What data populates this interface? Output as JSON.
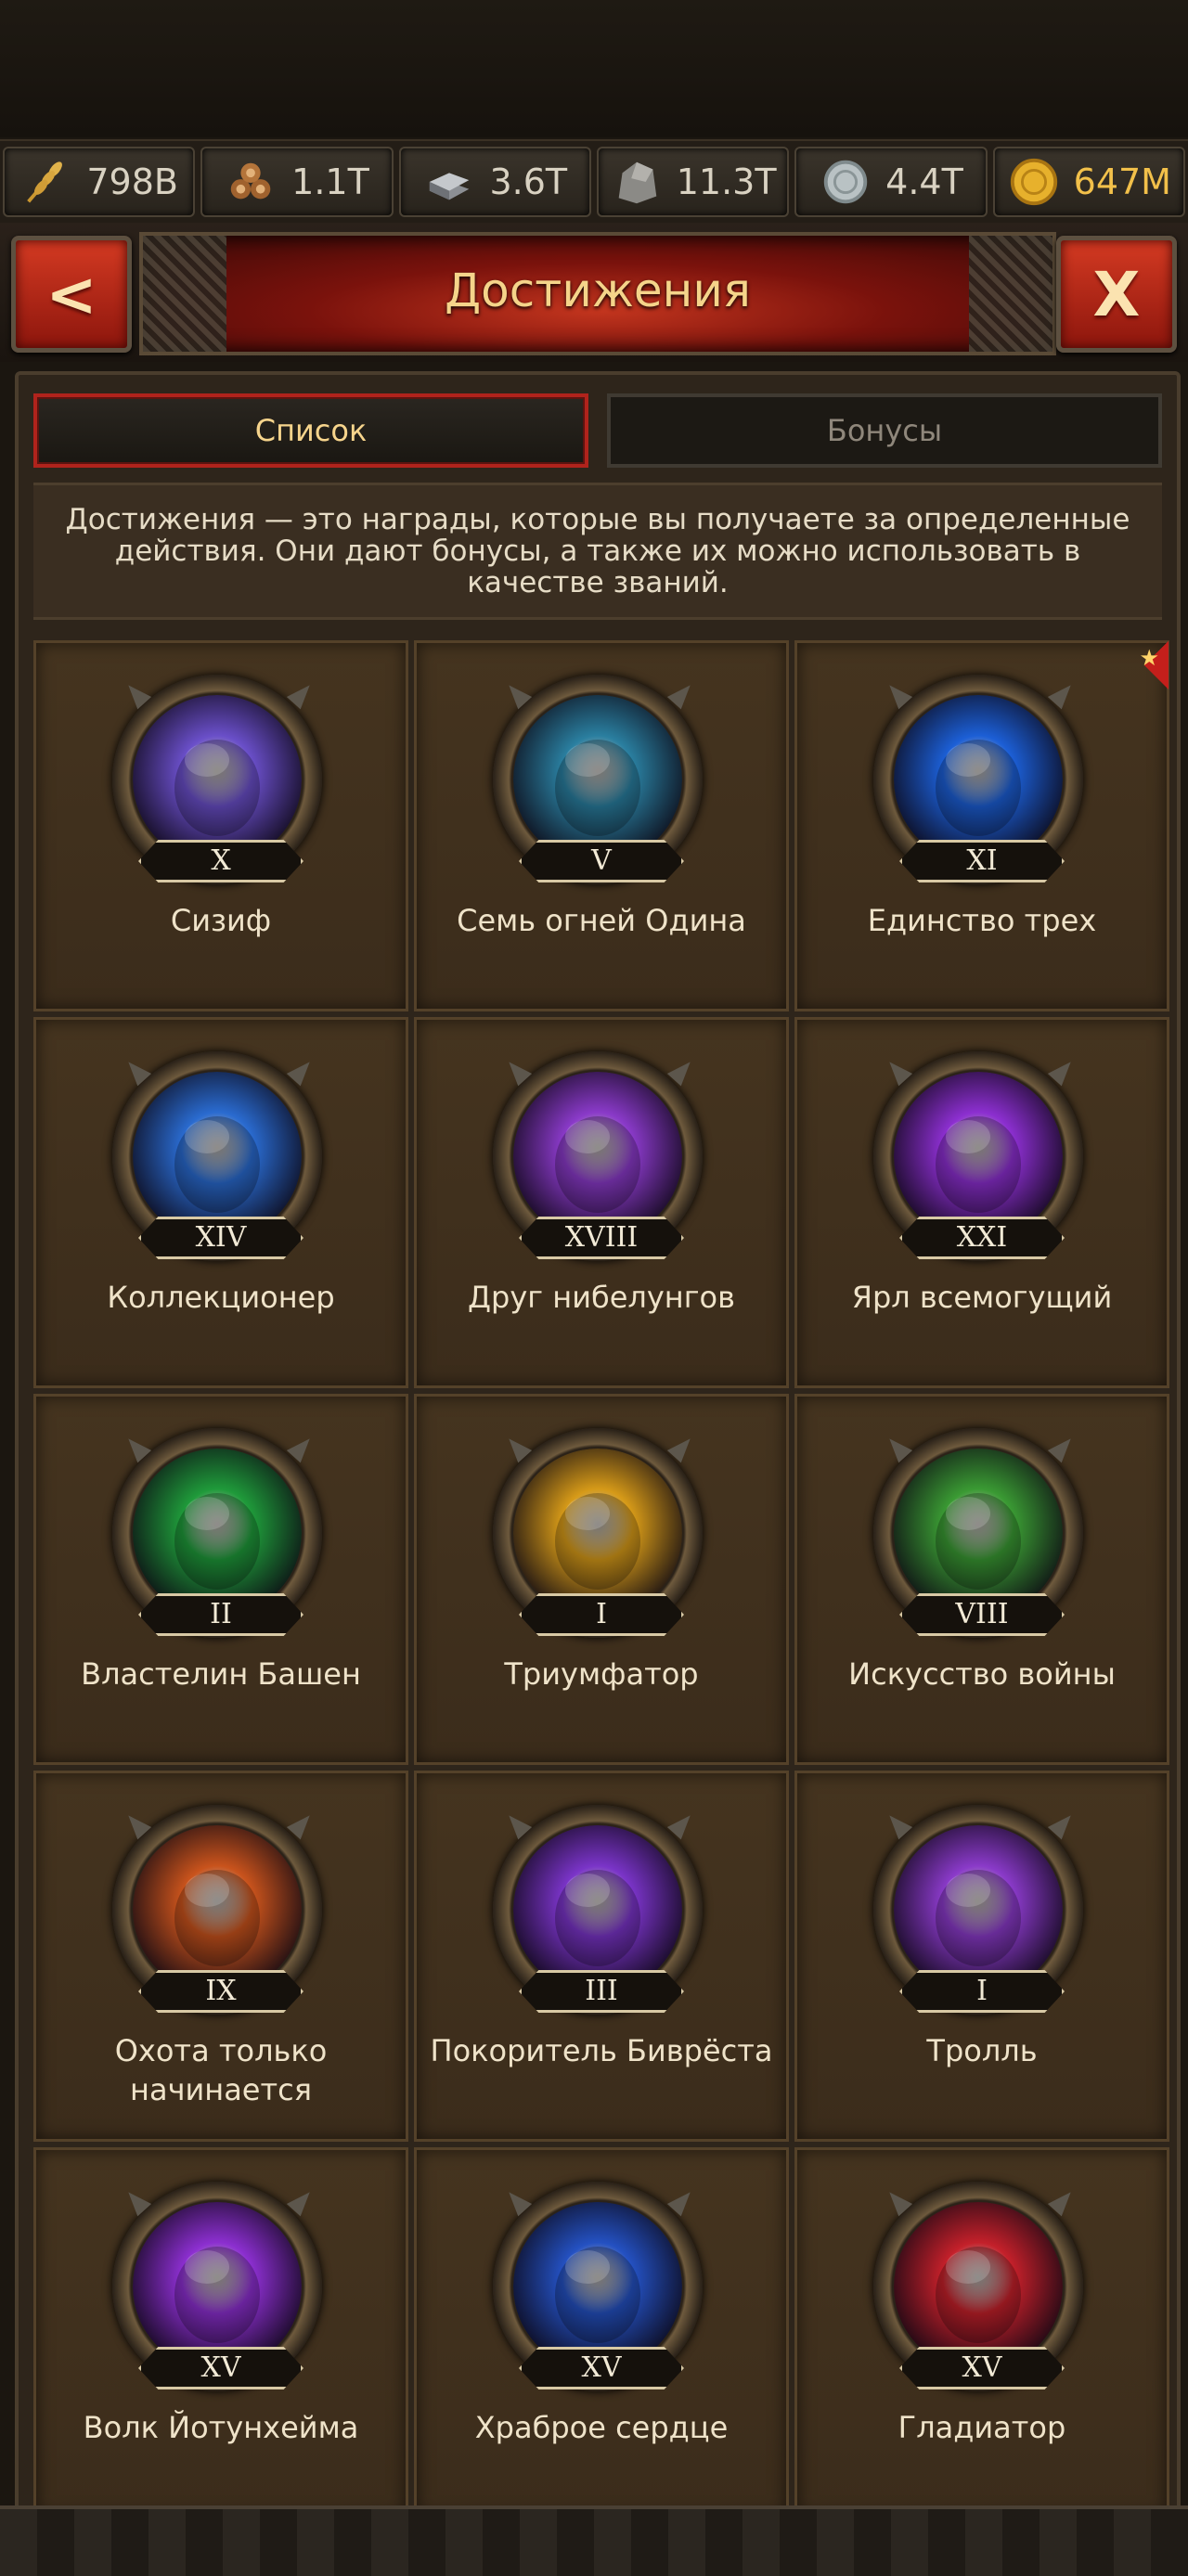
{
  "resources": [
    {
      "icon": "wheat-icon",
      "value": "798B"
    },
    {
      "icon": "wood-icon",
      "value": "1.1T"
    },
    {
      "icon": "iron-icon",
      "value": "3.6T"
    },
    {
      "icon": "stone-icon",
      "value": "11.3T"
    },
    {
      "icon": "silver-icon",
      "value": "4.4T"
    },
    {
      "icon": "gold-coin-icon",
      "value": "647M"
    }
  ],
  "header": {
    "title": "Достижения",
    "back_label": "<",
    "close_label": "X"
  },
  "tabs": [
    {
      "label": "Список",
      "active": true
    },
    {
      "label": "Бонусы",
      "active": false
    }
  ],
  "description": "Достижения — это награды, которые вы получаете за определенные действия. Они дают бонусы, а также их можно использовать в качестве званий.",
  "achievements": [
    {
      "name": "Сизиф",
      "rank": "X",
      "icon": "sisyphus-boulder-icon",
      "color": "#6a4fc9",
      "new": false
    },
    {
      "name": "Семь огней Одина",
      "rank": "V",
      "icon": "seven-fires-icon",
      "color": "#2a7fa0",
      "new": false
    },
    {
      "name": "Единство трех",
      "rank": "XI",
      "icon": "three-unity-sphere-icon",
      "color": "#1c5fd6",
      "new": true
    },
    {
      "name": "Коллекционер",
      "rank": "XIV",
      "icon": "collector-fist-icon",
      "color": "#2a6bd0",
      "new": false
    },
    {
      "name": "Друг нибелунгов",
      "rank": "XVIII",
      "icon": "treasure-chest-icon",
      "color": "#8a3ac9",
      "new": false
    },
    {
      "name": "Ярл всемогущий",
      "rank": "XXI",
      "icon": "flaming-sword-icon",
      "color": "#8c2fd0",
      "new": false
    },
    {
      "name": "Властелин Башен",
      "rank": "II",
      "icon": "tower-icon",
      "color": "#1f9a3a",
      "new": false
    },
    {
      "name": "Триумфатор",
      "rank": "I",
      "icon": "triumph-hand-icon",
      "color": "#d69a18",
      "new": false
    },
    {
      "name": "Искусство войны",
      "rank": "VIII",
      "icon": "war-mask-icon",
      "color": "#3a9a33",
      "new": false
    },
    {
      "name": "Охота только начинается",
      "rank": "IX",
      "icon": "hooded-hunter-icon",
      "color": "#c9531c",
      "new": false
    },
    {
      "name": "Покоритель Биврёста",
      "rank": "III",
      "icon": "rainbow-bridge-icon",
      "color": "#7a34c8",
      "new": false
    },
    {
      "name": "Тролль",
      "rank": "I",
      "icon": "troll-icon",
      "color": "#8a3ac9",
      "new": false
    },
    {
      "name": "Волк Йотунхейма",
      "rank": "XV",
      "icon": "banner-axe-icon",
      "color": "#8c2fd0",
      "new": false
    },
    {
      "name": "Храброе сердце",
      "rank": "XV",
      "icon": "braveheart-armor-icon",
      "color": "#2451c2",
      "new": false
    },
    {
      "name": "Гладиатор",
      "rank": "XV",
      "icon": "gladiator-helmet-icon",
      "color": "#c4202a",
      "new": false
    }
  ]
}
